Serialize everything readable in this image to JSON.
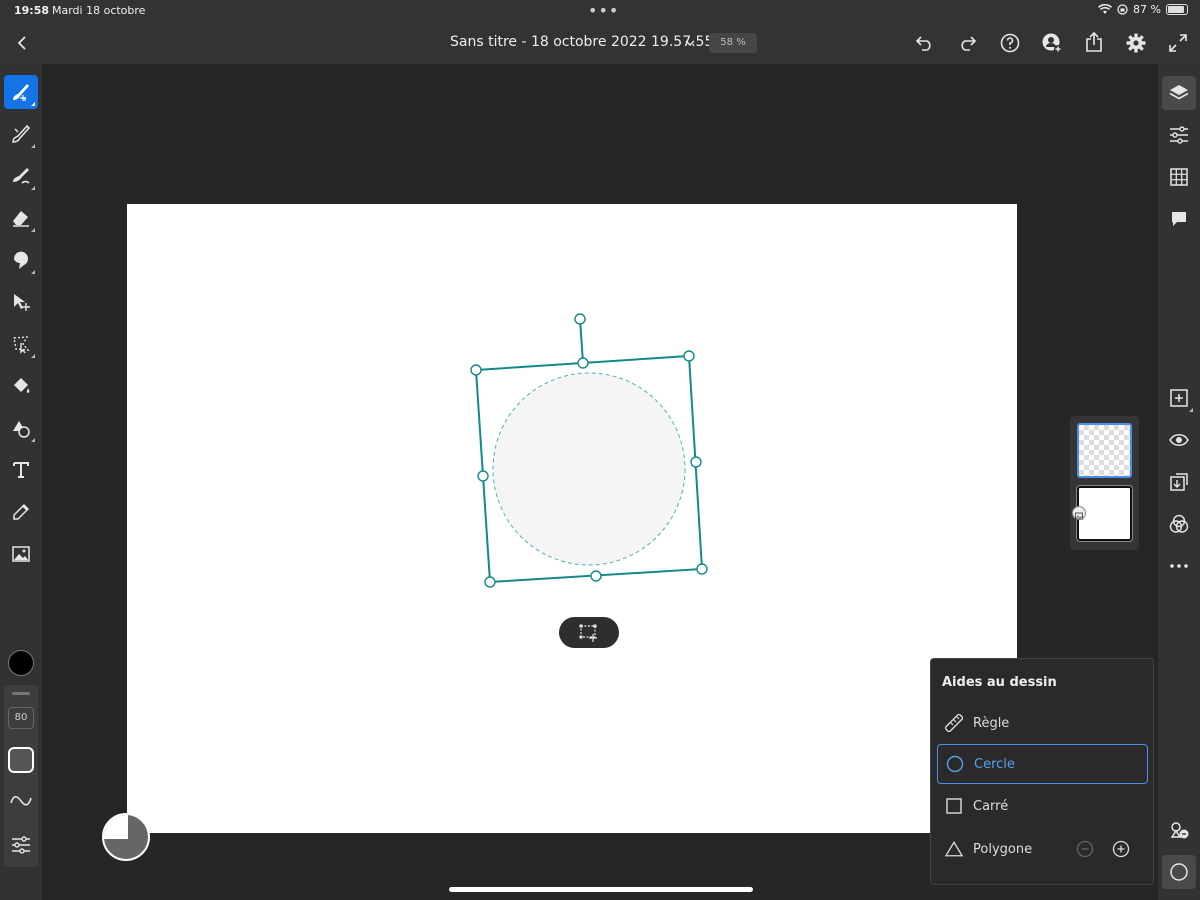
{
  "status_bar": {
    "time": "19:58",
    "date": "Mardi 18 octobre",
    "battery": "87 %",
    "battery_level": 0.87,
    "dots": "•••"
  },
  "header": {
    "title": "Sans titre - 18 octobre 2022 19.57.55 *",
    "zoom": "58 %",
    "icons": [
      "back-chevron-icon",
      "title-dropdown-icon",
      "undo-icon",
      "redo-icon",
      "help-icon",
      "user-add-icon",
      "share-icon",
      "settings-gear-icon",
      "fullscreen-icon"
    ]
  },
  "left_toolbar": {
    "tools": [
      "brush-select-icon",
      "brush-icon",
      "smudge-icon",
      "eraser-icon",
      "clone-icon",
      "move-icon",
      "lasso-icon",
      "fill-icon",
      "shapes-icon",
      "type-icon",
      "eyedropper-icon",
      "image-icon"
    ],
    "active_tool": "brush-select-icon",
    "color": "#000000",
    "brush_size": "80"
  },
  "right_toolbar": {
    "tools": [
      "layers-icon",
      "adjustments-icon",
      "grid-icon",
      "comments-icon",
      "add-layer-icon",
      "visibility-eye-icon",
      "layer-import-icon",
      "blend-modes-icon",
      "more-icon",
      "drawing-aids-icon",
      "circle-aid-icon"
    ]
  },
  "drawing_aids": {
    "title": "Aides au dessin",
    "items": [
      {
        "label": "Règle",
        "icon": "ruler-icon"
      },
      {
        "label": "Cercle",
        "icon": "circle-icon"
      },
      {
        "label": "Carré",
        "icon": "square-icon"
      },
      {
        "label": "Polygone",
        "icon": "triangle-icon"
      }
    ],
    "selected": "Cercle"
  },
  "colors": {
    "accent": "#1473e6",
    "guide": "#138a8a",
    "selected_aid": "#4a8fe8"
  }
}
